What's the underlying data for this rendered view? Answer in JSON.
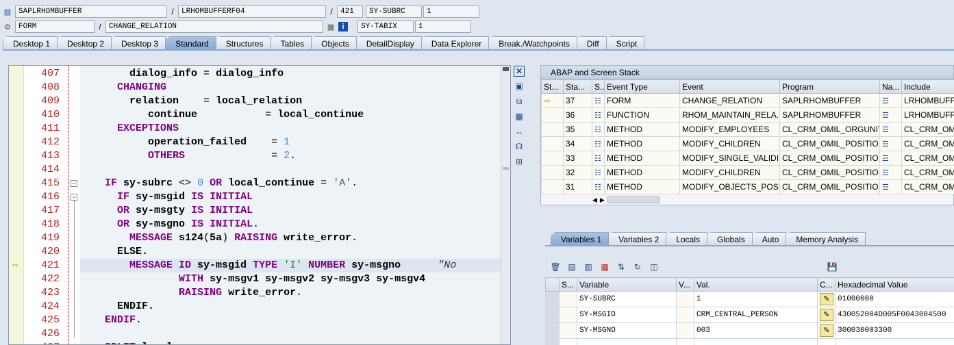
{
  "header": {
    "program": "SAPLRHOMBUFFER",
    "include": "LRHOMBUFFERF04",
    "line": "421",
    "event_type": "FORM",
    "event_name": "CHANGE_RELATION",
    "sysvar1_name": "SY-SUBRC",
    "sysvar1_value": "1",
    "sysvar2_name": "SY-TABIX",
    "sysvar2_value": "1",
    "slash": "/"
  },
  "tabs": [
    "Desktop 1",
    "Desktop 2",
    "Desktop 3",
    "Standard",
    "Structures",
    "Tables",
    "Objects",
    "DetailDisplay",
    "Data Explorer",
    "Break./Watchpoints",
    "Diff",
    "Script"
  ],
  "active_tab": "Standard",
  "code": {
    "current_line": "421",
    "lines": [
      {
        "n": "407",
        "segs": [
          [
            "p",
            "        "
          ],
          [
            "i",
            "dialog_info"
          ],
          [
            "p",
            " = "
          ],
          [
            "i",
            "dialog_info"
          ]
        ]
      },
      {
        "n": "408",
        "segs": [
          [
            "p",
            "      "
          ],
          [
            "k",
            "CHANGING"
          ]
        ]
      },
      {
        "n": "409",
        "segs": [
          [
            "p",
            "        "
          ],
          [
            "i",
            "relation"
          ],
          [
            "p",
            "    = "
          ],
          [
            "i",
            "local_relation"
          ]
        ]
      },
      {
        "n": "410",
        "segs": [
          [
            "p",
            "           "
          ],
          [
            "i",
            "continue"
          ],
          [
            "p",
            "           = "
          ],
          [
            "i",
            "local_continue"
          ]
        ]
      },
      {
        "n": "411",
        "segs": [
          [
            "p",
            "      "
          ],
          [
            "k",
            "EXCEPTIONS"
          ]
        ]
      },
      {
        "n": "412",
        "segs": [
          [
            "p",
            "           "
          ],
          [
            "i",
            "operation_failed"
          ],
          [
            "p",
            "    = "
          ],
          [
            "n",
            "1"
          ]
        ]
      },
      {
        "n": "413",
        "segs": [
          [
            "p",
            "           "
          ],
          [
            "k",
            "OTHERS"
          ],
          [
            "p",
            "              = "
          ],
          [
            "n",
            "2"
          ],
          [
            "p",
            "."
          ]
        ]
      },
      {
        "n": "414",
        "segs": []
      },
      {
        "n": "415",
        "segs": [
          [
            "p",
            "    "
          ],
          [
            "k",
            "IF"
          ],
          [
            "p",
            " "
          ],
          [
            "i",
            "sy-subrc"
          ],
          [
            "p",
            " <> "
          ],
          [
            "n",
            "0"
          ],
          [
            "p",
            " "
          ],
          [
            "k",
            "OR"
          ],
          [
            "p",
            " "
          ],
          [
            "i",
            "local_continue"
          ],
          [
            "p",
            " = "
          ],
          [
            "s",
            "'A'"
          ],
          [
            "p",
            "."
          ]
        ]
      },
      {
        "n": "416",
        "segs": [
          [
            "p",
            "      "
          ],
          [
            "k",
            "IF"
          ],
          [
            "p",
            " "
          ],
          [
            "i",
            "sy-msgid"
          ],
          [
            "p",
            " "
          ],
          [
            "k",
            "IS INITIAL"
          ]
        ]
      },
      {
        "n": "417",
        "segs": [
          [
            "p",
            "      "
          ],
          [
            "k",
            "OR"
          ],
          [
            "p",
            " "
          ],
          [
            "i",
            "sy-msgty"
          ],
          [
            "p",
            " "
          ],
          [
            "k",
            "IS INITIAL"
          ]
        ]
      },
      {
        "n": "418",
        "segs": [
          [
            "p",
            "      "
          ],
          [
            "k",
            "OR"
          ],
          [
            "p",
            " "
          ],
          [
            "i",
            "sy-msgno"
          ],
          [
            "p",
            " "
          ],
          [
            "k",
            "IS INITIAL"
          ],
          [
            "p",
            "."
          ]
        ]
      },
      {
        "n": "419",
        "segs": [
          [
            "p",
            "        "
          ],
          [
            "k",
            "MESSAGE"
          ],
          [
            "p",
            " "
          ],
          [
            "i",
            "s124"
          ],
          [
            "p",
            "("
          ],
          [
            "i",
            "5a"
          ],
          [
            "p",
            ") "
          ],
          [
            "k",
            "RAISING"
          ],
          [
            "p",
            " "
          ],
          [
            "i",
            "write_error"
          ],
          [
            "p",
            "."
          ]
        ]
      },
      {
        "n": "420",
        "segs": [
          [
            "p",
            "      "
          ],
          [
            "i",
            "ELSE."
          ]
        ]
      },
      {
        "n": "421",
        "segs": [
          [
            "p",
            "        "
          ],
          [
            "k",
            "MESSAGE ID"
          ],
          [
            "p",
            " "
          ],
          [
            "i",
            "sy-msgid"
          ],
          [
            "p",
            " "
          ],
          [
            "k",
            "TYPE"
          ],
          [
            "p",
            " "
          ],
          [
            "s",
            "'I'"
          ],
          [
            "p",
            " "
          ],
          [
            "k",
            "NUMBER"
          ],
          [
            "p",
            " "
          ],
          [
            "i",
            "sy-msgno"
          ],
          [
            "p",
            "      "
          ],
          [
            "c",
            "\"No"
          ]
        ]
      },
      {
        "n": "422",
        "segs": [
          [
            "p",
            "                "
          ],
          [
            "k",
            "WITH"
          ],
          [
            "p",
            " "
          ],
          [
            "i",
            "sy-msgv1 sy-msgv2 sy-msgv3 sy-msgv4"
          ]
        ]
      },
      {
        "n": "423",
        "segs": [
          [
            "p",
            "                "
          ],
          [
            "k",
            "RAISING"
          ],
          [
            "p",
            " "
          ],
          [
            "i",
            "write_error"
          ],
          [
            "p",
            "."
          ]
        ]
      },
      {
        "n": "424",
        "segs": [
          [
            "p",
            "      "
          ],
          [
            "i",
            "ENDIF."
          ]
        ]
      },
      {
        "n": "425",
        "segs": [
          [
            "p",
            "    "
          ],
          [
            "k",
            "ENDIF"
          ],
          [
            "p",
            "."
          ]
        ]
      },
      {
        "n": "426",
        "segs": []
      },
      {
        "n": "427",
        "segs": [
          [
            "p",
            "    "
          ],
          [
            "k",
            "SPLIT"
          ],
          [
            "p",
            " "
          ],
          [
            "i",
            "local_"
          ],
          [
            "p",
            "..."
          ]
        ]
      }
    ]
  },
  "stack_panel": {
    "title": "ABAP and Screen Stack",
    "columns": [
      "St...",
      "Sta...",
      "S...",
      "Event Type",
      "Event",
      "Program",
      "Na...",
      "Include"
    ],
    "rows": [
      [
        "37",
        "FORM",
        "CHANGE_RELATION",
        "SAPLRHOMBUFFER",
        "LRHOMBUFFER"
      ],
      [
        "36",
        "FUNCTION",
        "RHOM_MAINTAIN_RELA...",
        "SAPLRHOMBUFFER",
        "LRHOMBUFFER"
      ],
      [
        "35",
        "METHOD",
        "MODIFY_EMPLOYEES",
        "CL_CRM_OMIL_ORGUNIT...",
        "CL_CRM_OMIL"
      ],
      [
        "34",
        "METHOD",
        "MODIFY_CHILDREN",
        "CL_CRM_OMIL_POSITIO...",
        "CL_CRM_OMIL"
      ],
      [
        "33",
        "METHOD",
        "MODIFY_SINGLE_VALIDI...",
        "CL_CRM_OMIL_POSITIO...",
        "CL_CRM_OMIL"
      ],
      [
        "32",
        "METHOD",
        "MODIFY_CHILDREN",
        "CL_CRM_OMIL_POSITIO...",
        "CL_CRM_OMIL"
      ],
      [
        "31",
        "METHOD",
        "MODIFY_OBJECTS_POSI...",
        "CL_CRM_OMIL_POSITIO...",
        "CL_CRM_OMIL"
      ]
    ]
  },
  "var_tabs": [
    "Variables 1",
    "Variables 2",
    "Locals",
    "Globals",
    "Auto",
    "Memory Analysis"
  ],
  "active_var_tab": "Variables 1",
  "variables": {
    "columns": [
      "S...",
      "Variable",
      "V...",
      "Val.",
      "C...",
      "Hexadecimal Value"
    ],
    "rows": [
      [
        "SY-SUBRC",
        "1",
        "01000000"
      ],
      [
        "SY-MSGID",
        "CRM_CENTRAL_PERSON",
        "430052004D005F0043004500"
      ],
      [
        "SY-MSGNO",
        "003",
        "300030003300"
      ]
    ]
  },
  "colors": {
    "keyword": "#800080",
    "number": "#3a8fd8",
    "string": "#2a7a2a",
    "line_number": "#b22222",
    "active_tab": "#88a9d5"
  }
}
